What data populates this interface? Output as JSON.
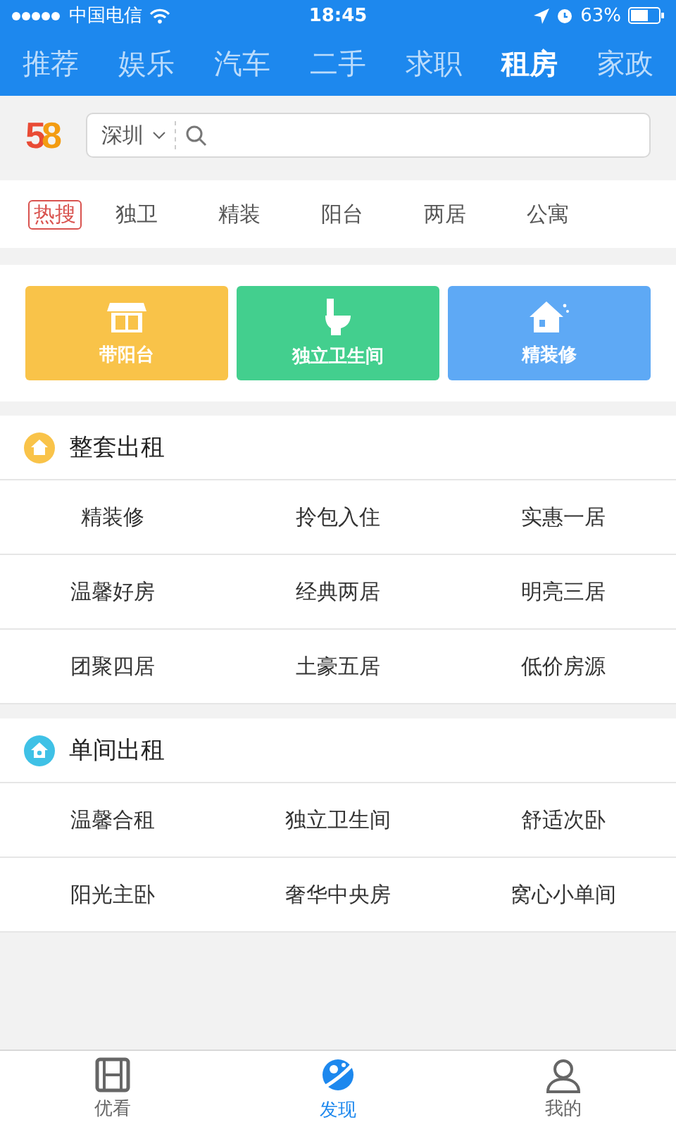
{
  "status_bar": {
    "carrier": "中国电信",
    "time": "18:45",
    "battery": "63%"
  },
  "nav_tabs": [
    {
      "label": "推荐",
      "selected": false
    },
    {
      "label": "娱乐",
      "selected": false
    },
    {
      "label": "汽车",
      "selected": false
    },
    {
      "label": "二手",
      "selected": false
    },
    {
      "label": "求职",
      "selected": false
    },
    {
      "label": "租房",
      "selected": true
    },
    {
      "label": "家政",
      "selected": false
    }
  ],
  "logo": {
    "digit_1": "5",
    "digit_2": "8"
  },
  "search": {
    "city": "深圳"
  },
  "hot_search": {
    "label": "热搜",
    "words": [
      "独卫",
      "精装",
      "阳台",
      "两居",
      "公寓"
    ]
  },
  "quick_buttons": [
    {
      "kind": "balcony",
      "label": "带阳台",
      "color": "#f9c349"
    },
    {
      "kind": "toilet",
      "label": "独立卫生间",
      "color": "#43cf8e"
    },
    {
      "kind": "house",
      "label": "精装修",
      "color": "#5ea9f5"
    }
  ],
  "sections": [
    {
      "kind": "whole",
      "title": "整套出租",
      "color": "#f9c349",
      "items": [
        "精装修",
        "拎包入住",
        "实惠一居",
        "温馨好房",
        "经典两居",
        "明亮三居",
        "团聚四居",
        "土豪五居",
        "低价房源"
      ]
    },
    {
      "kind": "single",
      "title": "单间出租",
      "color": "#3fc1e6",
      "items": [
        "温馨合租",
        "独立卫生间",
        "舒适次卧",
        "阳光主卧",
        "奢华中央房",
        "窝心小单间"
      ]
    }
  ],
  "bottom_tabs": [
    {
      "kind": "film",
      "label": "优看",
      "selected": false
    },
    {
      "kind": "planet",
      "label": "发现",
      "selected": true
    },
    {
      "kind": "person",
      "label": "我的",
      "selected": false
    }
  ]
}
